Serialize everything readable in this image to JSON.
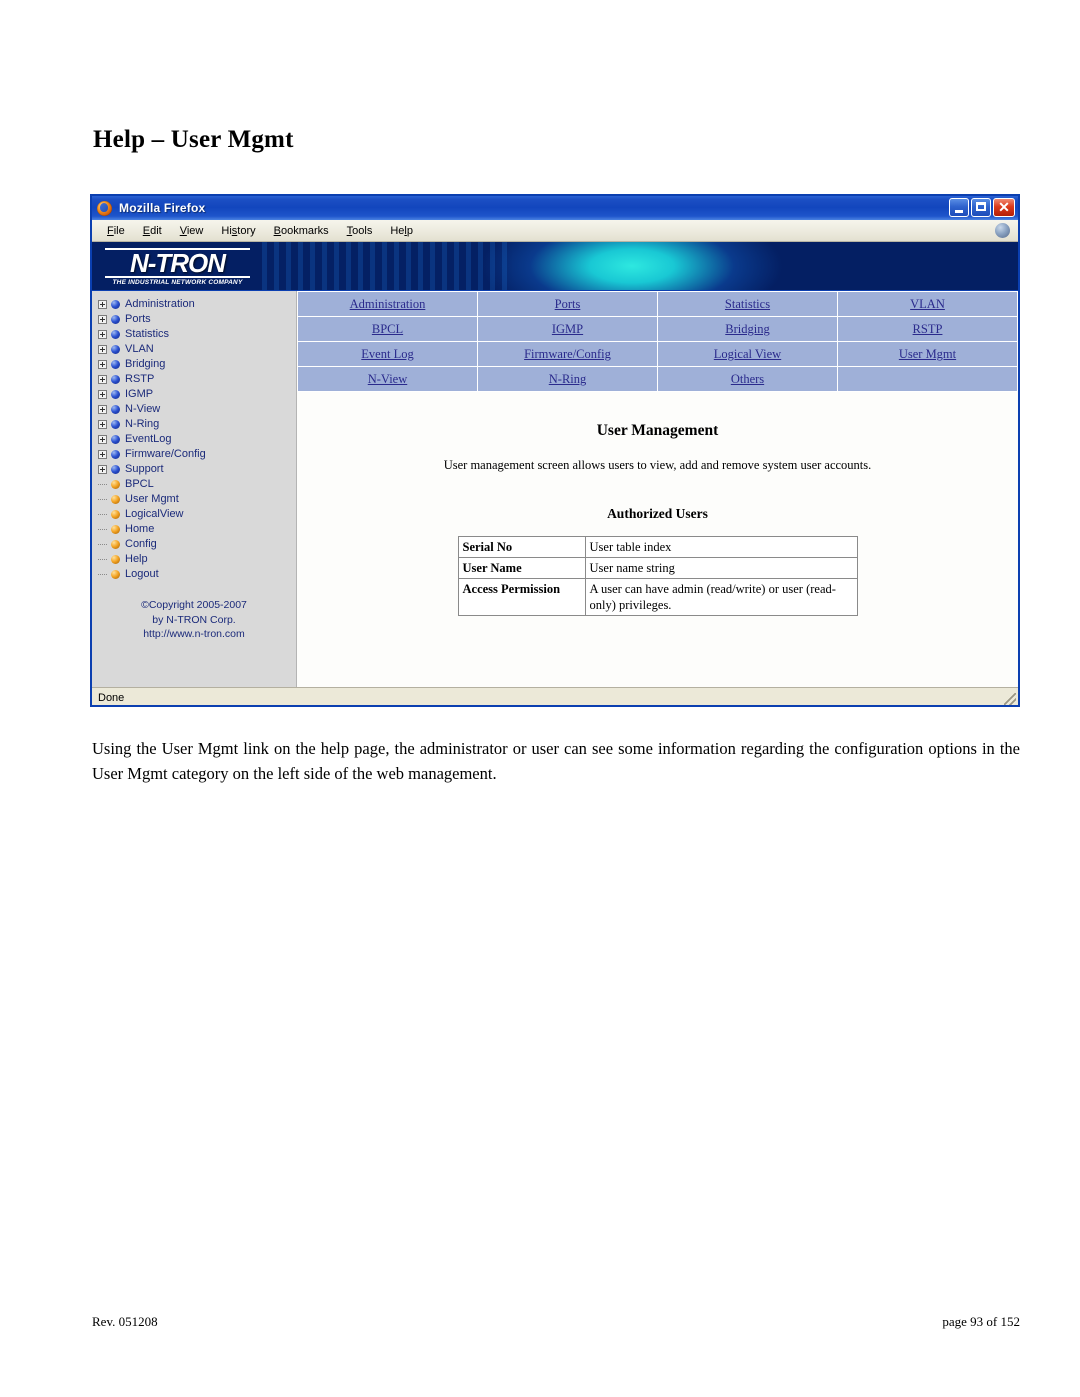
{
  "document": {
    "title": "Help – User Mgmt",
    "paragraph": "Using the User Mgmt link on the help page, the administrator or user can see some information regarding the configuration options in the User Mgmt category on the left side of the web management.",
    "footer": {
      "revision": "Rev.  051208",
      "page": "page 93 of 152"
    }
  },
  "browser": {
    "window_title": "Mozilla Firefox",
    "window_controls": {
      "minimize": "Minimize",
      "maximize": "Restore",
      "close": "Close"
    },
    "menu": [
      {
        "pre": "",
        "acc": "F",
        "post": "ile"
      },
      {
        "pre": "",
        "acc": "E",
        "post": "dit"
      },
      {
        "pre": "",
        "acc": "V",
        "post": "iew"
      },
      {
        "pre": "Hi",
        "acc": "s",
        "post": "tory"
      },
      {
        "pre": "",
        "acc": "B",
        "post": "ookmarks"
      },
      {
        "pre": "",
        "acc": "T",
        "post": "ools"
      },
      {
        "pre": "He",
        "acc": "l",
        "post": "p"
      }
    ],
    "status": "Done"
  },
  "banner": {
    "logo_text": "N-TRON",
    "logo_tagline": "THE INDUSTRIAL NETWORK COMPANY"
  },
  "sidebar": {
    "nodes": [
      {
        "label": "Administration",
        "type": "branch"
      },
      {
        "label": "Ports",
        "type": "branch"
      },
      {
        "label": "Statistics",
        "type": "branch"
      },
      {
        "label": "VLAN",
        "type": "branch"
      },
      {
        "label": "Bridging",
        "type": "branch"
      },
      {
        "label": "RSTP",
        "type": "branch"
      },
      {
        "label": "IGMP",
        "type": "branch"
      },
      {
        "label": "N-View",
        "type": "branch"
      },
      {
        "label": "N-Ring",
        "type": "branch"
      },
      {
        "label": "EventLog",
        "type": "branch"
      },
      {
        "label": "Firmware/Config",
        "type": "branch"
      },
      {
        "label": "Support",
        "type": "branch"
      },
      {
        "label": "BPCL",
        "type": "leaf"
      },
      {
        "label": "User Mgmt",
        "type": "leaf"
      },
      {
        "label": "LogicalView",
        "type": "leaf"
      },
      {
        "label": "Home",
        "type": "leaf"
      },
      {
        "label": "Config",
        "type": "leaf"
      },
      {
        "label": "Help",
        "type": "leaf"
      },
      {
        "label": "Logout",
        "type": "leaf"
      }
    ],
    "copyright": {
      "line1": "©Copyright 2005-2007",
      "line2": "by N-TRON Corp.",
      "line3": "http://www.n-tron.com"
    }
  },
  "nav_grid": {
    "rows": [
      [
        "Administration",
        "Ports",
        "Statistics",
        "VLAN"
      ],
      [
        "BPCL",
        "IGMP",
        "Bridging",
        "RSTP"
      ],
      [
        "Event Log",
        "Firmware/Config",
        "Logical View",
        "User Mgmt"
      ],
      [
        "N-View",
        "N-Ring",
        "Others",
        ""
      ]
    ]
  },
  "main": {
    "heading": "User Management",
    "description": "User management screen allows users to view, add and remove system user accounts.",
    "subheading": "Authorized Users",
    "table": {
      "rows": [
        {
          "label": "Serial No",
          "value": "User table index"
        },
        {
          "label": "User Name",
          "value": "User name string"
        },
        {
          "label": "Access Permission",
          "value": "A user can have admin (read/write) or user (read-only) privileges."
        }
      ]
    }
  },
  "colors": {
    "titlebar_blue": "#1246bd",
    "nav_grid_bg": "#9fb0d8",
    "link_blue": "#2a2a8c",
    "sidebar_bg": "#d9d9d9",
    "sidebar_text": "#1b2a7a"
  }
}
